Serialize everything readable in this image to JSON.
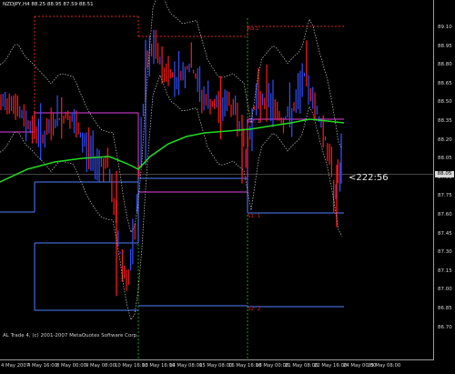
{
  "chart": {
    "symbol_line": "NZDJPY,H4  88.25 88.95 87.59 88.51",
    "footer": "AL Trade 4, (c) 2001-2007 MetaQuotes Software Corp.",
    "timer": "<222:56",
    "current_price": "88.05",
    "zone_labels": [
      {
        "text": "R3.1",
        "color": "#e02020"
      },
      {
        "text": "R2: 1",
        "color": "#d040d0"
      },
      {
        "text": "S1: 1",
        "color": "#e02020"
      },
      {
        "text": "S2: 2",
        "color": "#e02020"
      }
    ],
    "y_ticks": [
      "89.10",
      "88.95",
      "88.80",
      "88.65",
      "88.50",
      "88.35",
      "88.20",
      "88.05",
      "87.90",
      "87.75",
      "87.60",
      "87.45",
      "87.30",
      "87.15",
      "87.00",
      "86.85",
      "86.70"
    ],
    "x_ticks": [
      "4 May 2007",
      "4 May 16:00",
      "8 May 00:00",
      "9 May 08:00",
      "10 May 16:00",
      "13 May 16:00",
      "14 May 08:00",
      "15 May 08:00",
      "16 May 16:00",
      "18 May 00:00",
      "21 May 08:00",
      "22 May 16:00",
      "24 May 00:00",
      "25 May 08:00"
    ],
    "colors": {
      "background": "#000000",
      "bull_bar": "#3050ff",
      "bear_bar": "#ff1a1a",
      "ma_line": "#22dd22",
      "envelope": "#c8c8c8",
      "resistance": "#e02020",
      "pivot_magenta": "#e040e0",
      "support_blue": "#5080ff",
      "session_green": "#18a018"
    }
  }
}
